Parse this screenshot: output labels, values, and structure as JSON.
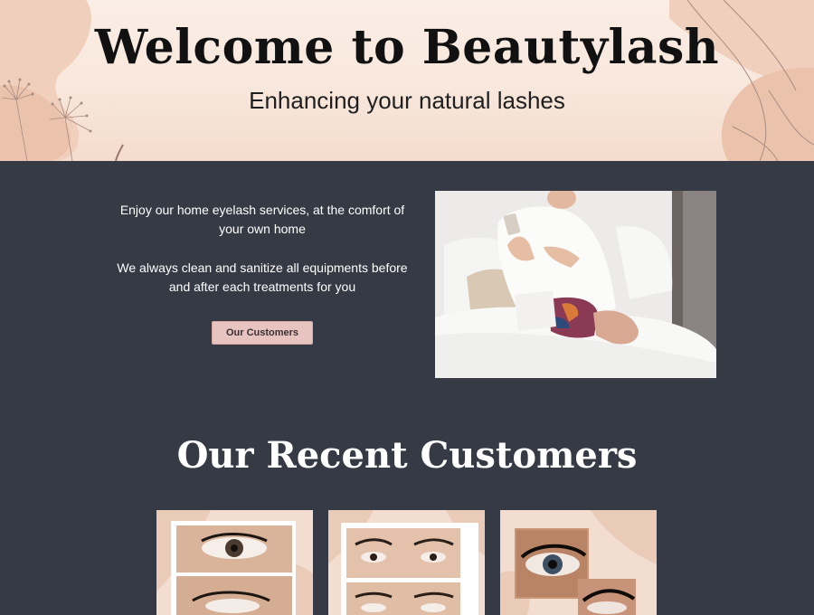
{
  "hero": {
    "title": "Welcome to Beautylash",
    "subtitle": "Enhancing your natural lashes"
  },
  "services": {
    "paragraph1": "Enjoy our home eyelash services, at the comfort of your own home",
    "paragraph2": "We always clean and sanitize all equipments before and after each treatments for you",
    "button_label": "Our Customers"
  },
  "recent": {
    "heading": "Our Recent Customers"
  },
  "colors": {
    "page_background": "#363a45",
    "hero_background": "#f8e7dc",
    "button_background": "#e8c4c0",
    "card_background": "#f3ddd0"
  }
}
